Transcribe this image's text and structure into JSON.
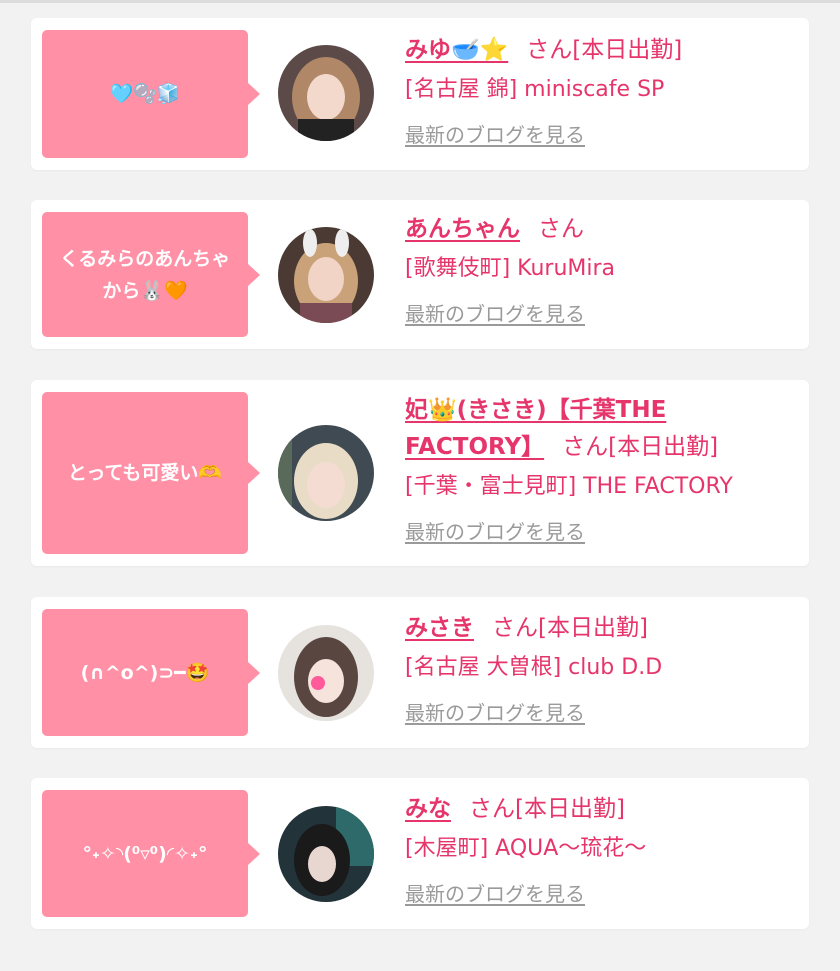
{
  "cards": [
    {
      "message": "🩵🫧🧊",
      "name": "みゆ🥣⭐",
      "san": "さん",
      "status": "[本日出勤]",
      "shop": "[名古屋 錦] miniscafe SP",
      "blog": "最新のブログを見る"
    },
    {
      "message": "くるみらのあんちゃから🐰🧡",
      "name": "あんちゃん",
      "san": "さん",
      "status": "",
      "shop": "[歌舞伎町] KuruMira",
      "blog": "最新のブログを見る"
    },
    {
      "message": "とっても可愛い🫶",
      "name": "妃👑(きさき)【千葉THE FACTORY】",
      "san": "さん",
      "status": "[本日出勤]",
      "shop": "[千葉・富士見町] THE FACTORY",
      "blog": "最新のブログを見る"
    },
    {
      "message": "(∩^o^)⊃━🤩",
      "name": "みさき",
      "san": "さん",
      "status": "[本日出勤]",
      "shop": "[名古屋 大曽根] club D.D",
      "blog": "最新のブログを見る"
    },
    {
      "message": "°˖✧◝(⁰▿⁰)◜✧˖°",
      "name": "みな",
      "san": "さん",
      "status": "[本日出勤]",
      "shop": "[木屋町] AQUA～琉花～",
      "blog": "最新のブログを見る"
    }
  ],
  "colors": {
    "bubble": "#ff90a6",
    "accent": "#e6356b",
    "link_gray": "#9a9a9a",
    "background": "#f2f2f2"
  }
}
